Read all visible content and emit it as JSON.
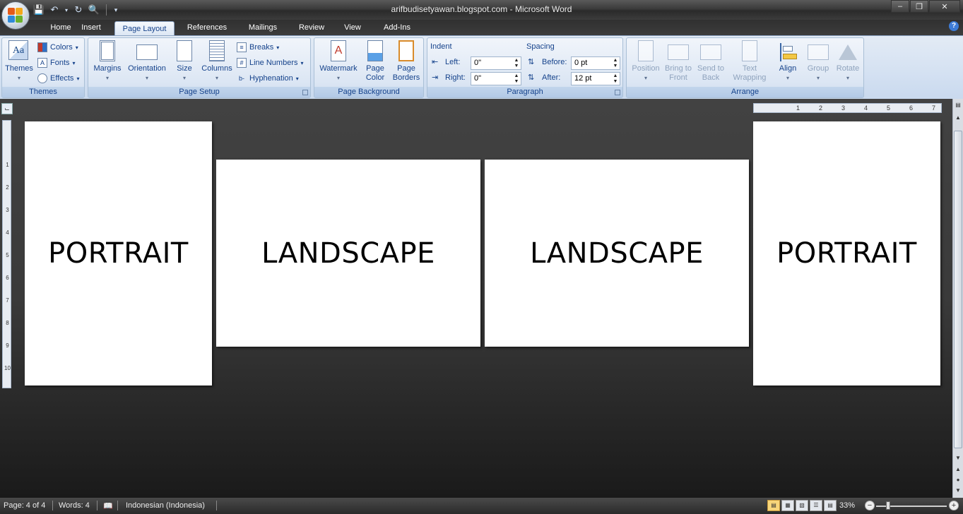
{
  "window": {
    "title": "arifbudisetyawan.blogspot.com - Microsoft Word",
    "controls": {
      "minimize": "–",
      "restore": "❐",
      "close": "✕"
    }
  },
  "qat": {
    "save_icon": "save-icon",
    "undo_icon": "undo-icon",
    "redo_icon": "redo-icon",
    "preview_icon": "print-preview-icon"
  },
  "tabs": [
    {
      "label": "Home"
    },
    {
      "label": "Insert"
    },
    {
      "label": "Page Layout",
      "active": true
    },
    {
      "label": "References"
    },
    {
      "label": "Mailings"
    },
    {
      "label": "Review"
    },
    {
      "label": "View"
    },
    {
      "label": "Add-Ins"
    }
  ],
  "ribbon": {
    "themes": {
      "label": "Themes",
      "themes_btn": "Themes",
      "colors": "Colors",
      "fonts": "Fonts",
      "effects": "Effects"
    },
    "page_setup": {
      "label": "Page Setup",
      "margins": "Margins",
      "orientation": "Orientation",
      "size": "Size",
      "columns": "Columns",
      "breaks": "Breaks",
      "line_numbers": "Line Numbers",
      "hyphenation": "Hyphenation"
    },
    "page_background": {
      "label": "Page Background",
      "watermark": "Watermark",
      "page_color_1": "Page",
      "page_color_2": "Color",
      "page_borders_1": "Page",
      "page_borders_2": "Borders"
    },
    "paragraph": {
      "label": "Paragraph",
      "indent_title": "Indent",
      "left_label": "Left:",
      "left_value": "0\"",
      "right_label": "Right:",
      "right_value": "0\"",
      "spacing_title": "Spacing",
      "before_label": "Before:",
      "before_value": "0 pt",
      "after_label": "After:",
      "after_value": "12 pt"
    },
    "arrange": {
      "label": "Arrange",
      "position": "Position",
      "bring_front_1": "Bring to",
      "bring_front_2": "Front",
      "send_back_1": "Send to",
      "send_back_2": "Back",
      "text_wrap_1": "Text",
      "text_wrap_2": "Wrapping",
      "align": "Align",
      "group": "Group",
      "rotate": "Rotate"
    }
  },
  "pages": [
    {
      "text": "PORTRAIT",
      "orientation": "portrait"
    },
    {
      "text": "LANDSCAPE",
      "orientation": "landscape"
    },
    {
      "text": "LANDSCAPE",
      "orientation": "landscape"
    },
    {
      "text": "PORTRAIT",
      "orientation": "portrait"
    }
  ],
  "rulers": {
    "vertical_ticks": [
      "1",
      "2",
      "3",
      "4",
      "5",
      "6",
      "7",
      "8",
      "9",
      "10"
    ],
    "horizontal_ticks": [
      "1",
      "2",
      "3",
      "4",
      "5",
      "6",
      "7"
    ]
  },
  "statusbar": {
    "page": "Page: 4 of 4",
    "words": "Words: 4",
    "language": "Indonesian (Indonesia)",
    "zoom": "33%",
    "zoom_minus": "−",
    "zoom_plus": "+"
  }
}
